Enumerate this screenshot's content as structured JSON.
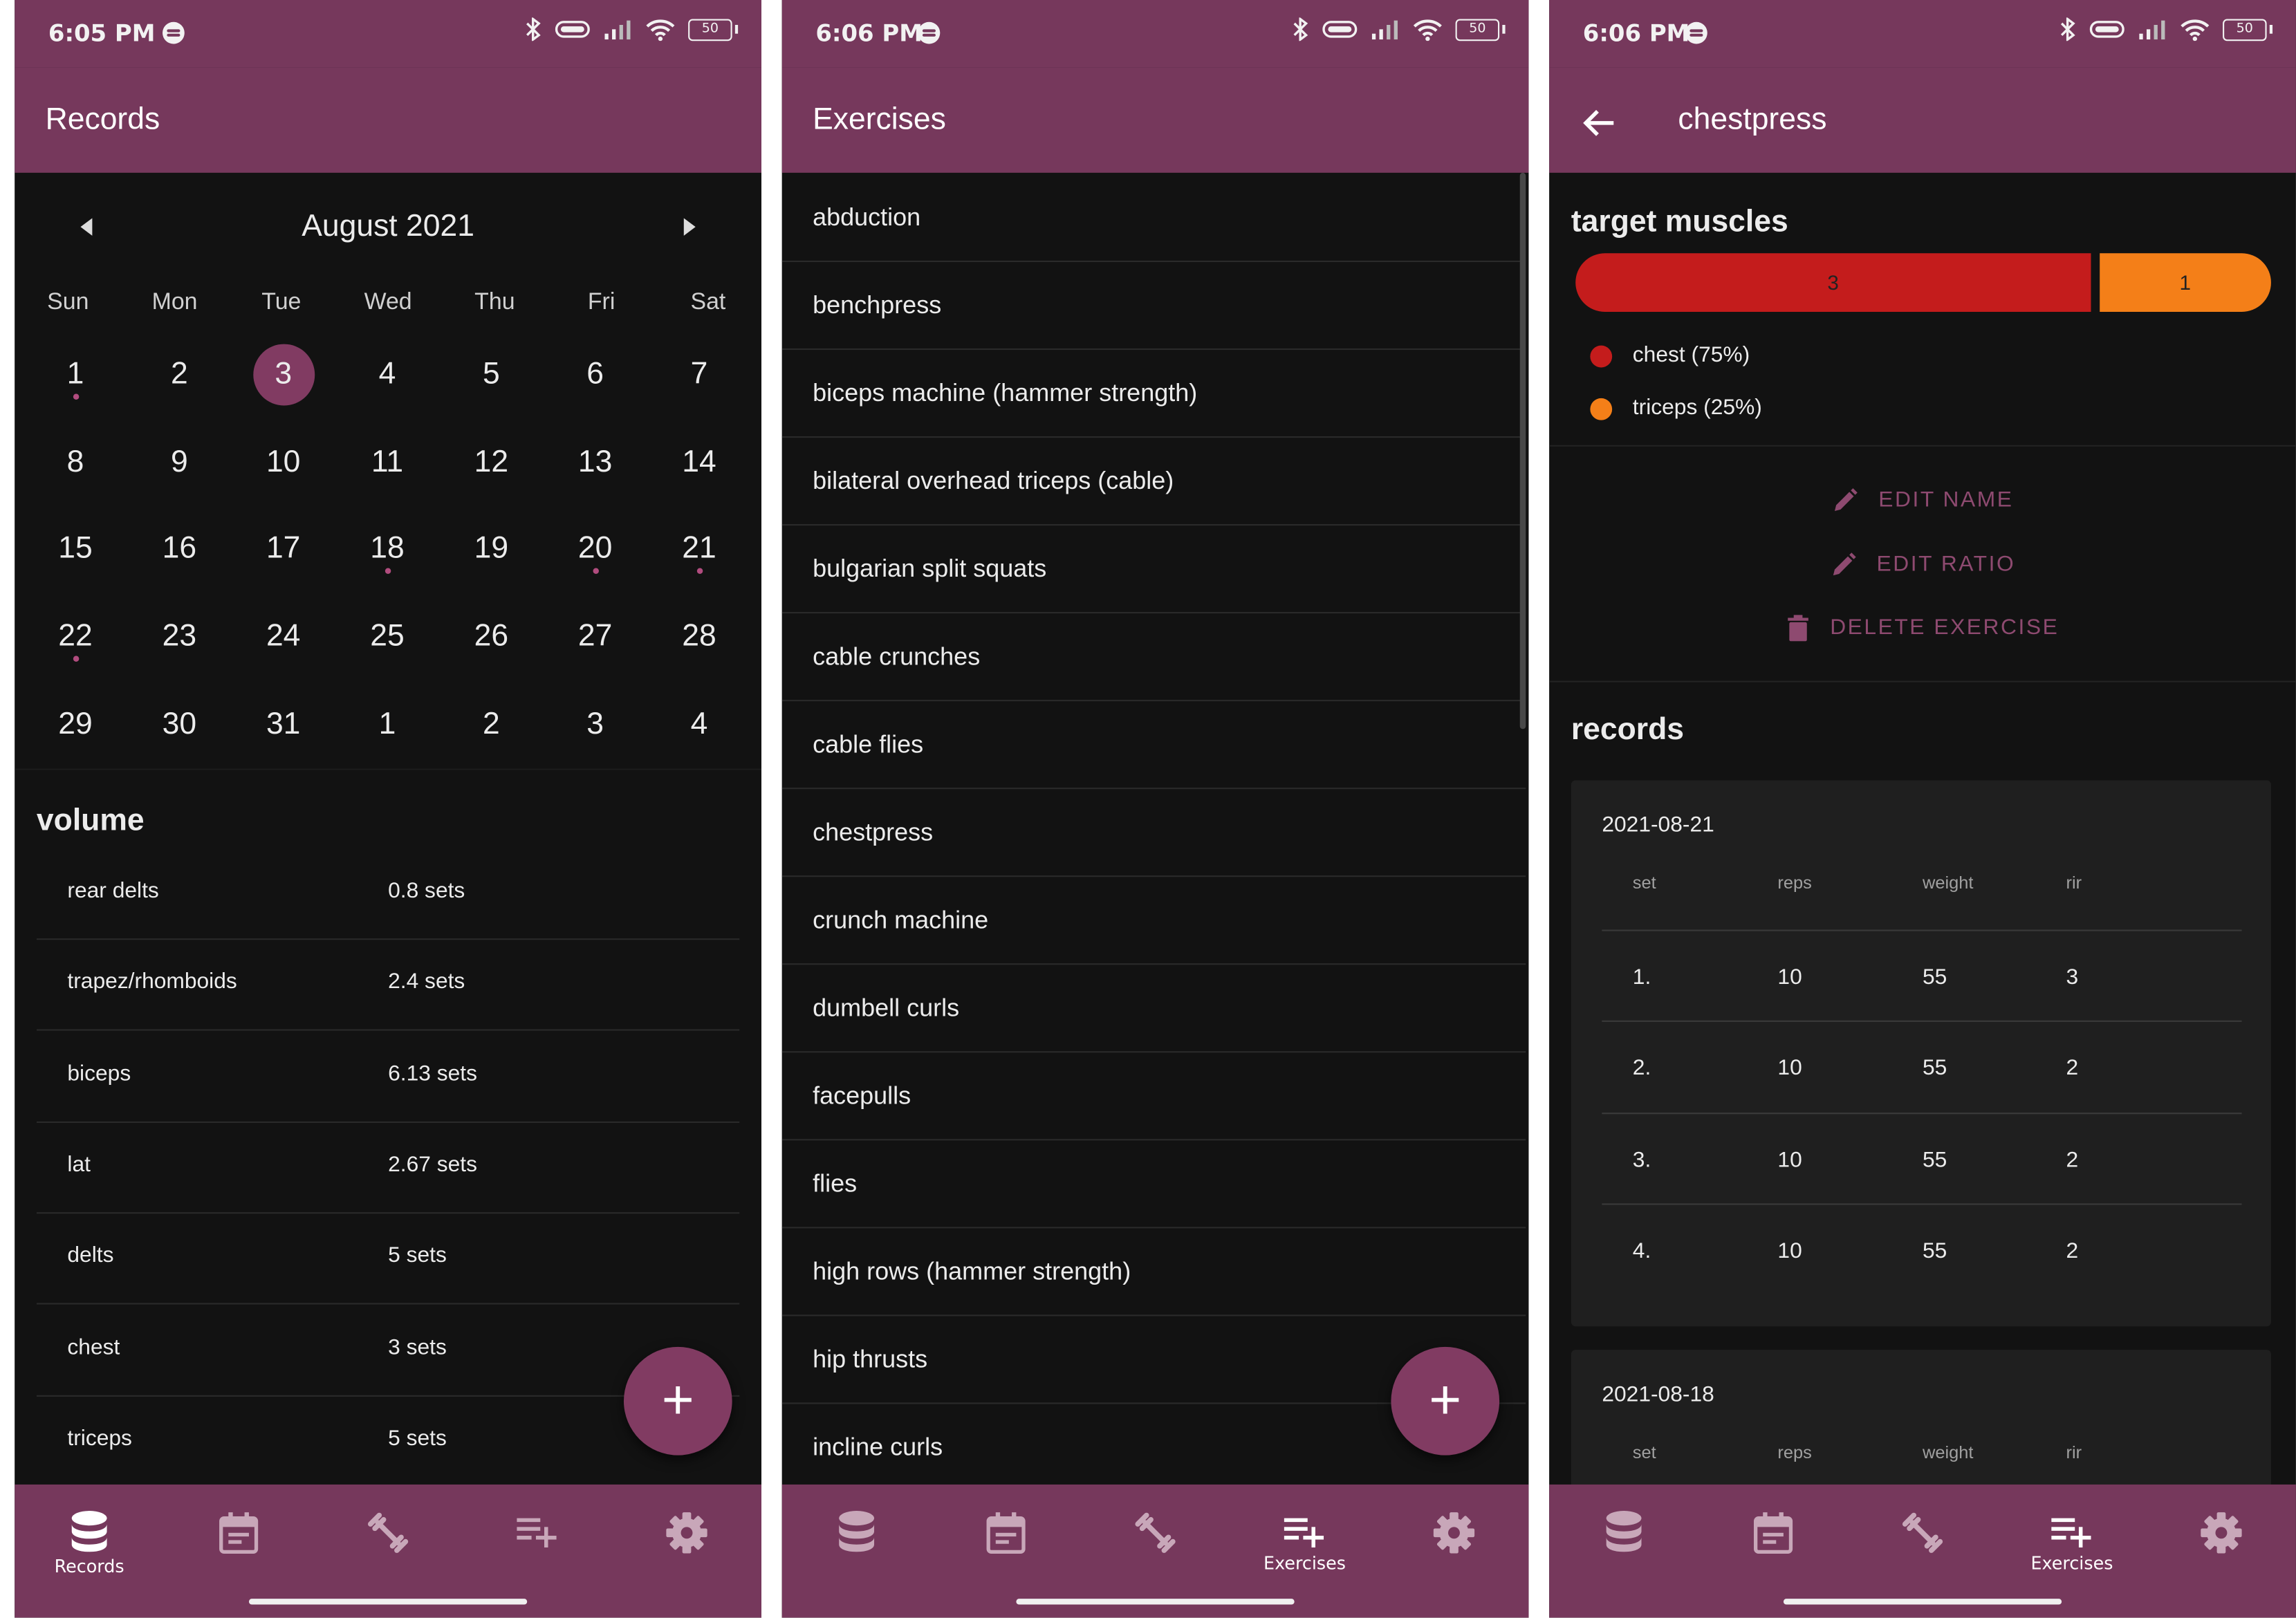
{
  "screens": [
    {
      "status_time": "6:05 PM",
      "battery": "50",
      "title": "Records",
      "calendar": {
        "month": "August 2021",
        "weekdays": [
          "Sun",
          "Mon",
          "Tue",
          "Wed",
          "Thu",
          "Fri",
          "Sat"
        ],
        "days": [
          "1",
          "2",
          "3",
          "4",
          "5",
          "6",
          "7",
          "8",
          "9",
          "10",
          "11",
          "12",
          "13",
          "14",
          "15",
          "16",
          "17",
          "18",
          "19",
          "20",
          "21",
          "22",
          "23",
          "24",
          "25",
          "26",
          "27",
          "28",
          "29",
          "30",
          "31",
          "1",
          "2",
          "3",
          "4"
        ],
        "selected_day": "3",
        "days_with_records": [
          "1",
          "18",
          "20",
          "21",
          "22"
        ]
      },
      "volume": {
        "title": "volume",
        "rows": [
          {
            "muscle": "rear delts",
            "value": "0.8 sets"
          },
          {
            "muscle": "trapez/rhomboids",
            "value": "2.4 sets"
          },
          {
            "muscle": "biceps",
            "value": "6.13 sets"
          },
          {
            "muscle": "lat",
            "value": "2.67 sets"
          },
          {
            "muscle": "delts",
            "value": "5 sets"
          },
          {
            "muscle": "chest",
            "value": "3 sets"
          },
          {
            "muscle": "triceps",
            "value": "5 sets"
          }
        ]
      },
      "fab": "+",
      "nav_active_label": "Records"
    },
    {
      "status_time": "6:06 PM",
      "battery": "50",
      "title": "Exercises",
      "exercises": [
        "abduction",
        "benchpress",
        "biceps machine (hammer strength)",
        "bilateral overhead triceps (cable)",
        "bulgarian split squats",
        "cable crunches",
        "cable flies",
        "chestpress",
        "crunch machine",
        "dumbell curls",
        "facepulls",
        "flies",
        "high rows (hammer strength)",
        "hip thrusts",
        "incline curls"
      ],
      "fab": "+",
      "nav_active_label": "Exercises"
    },
    {
      "status_time": "6:06 PM",
      "battery": "50",
      "title": "chestpress",
      "target_muscles": {
        "title": "target muscles",
        "ratio": [
          {
            "label": "3",
            "share": 0.75,
            "color": "#c41c1c"
          },
          {
            "label": "1",
            "share": 0.25,
            "color": "#f47f18"
          }
        ],
        "legend": [
          {
            "text": "chest (75%)",
            "color": "#c41c1c"
          },
          {
            "text": "triceps (25%)",
            "color": "#f47f18"
          }
        ]
      },
      "actions": {
        "edit_name": "EDIT NAME",
        "edit_ratio": "EDIT RATIO",
        "delete": "DELETE EXERCISE"
      },
      "records": {
        "title": "records",
        "columns": [
          "set",
          "reps",
          "weight",
          "rir"
        ],
        "sessions": [
          {
            "date": "2021-08-21",
            "rows": [
              [
                "1.",
                "10",
                "55",
                "3"
              ],
              [
                "2.",
                "10",
                "55",
                "2"
              ],
              [
                "3.",
                "10",
                "55",
                "2"
              ],
              [
                "4.",
                "10",
                "55",
                "2"
              ]
            ]
          },
          {
            "date": "2021-08-18",
            "rows": []
          }
        ]
      },
      "nav_active_label": "Exercises"
    }
  ],
  "colors": {
    "bar": "#76385c",
    "accent": "#813b62",
    "background": "#121212",
    "card": "#1f1f1f"
  },
  "nav_icons": [
    "database-icon",
    "calendar-icon",
    "dumbbell-icon",
    "playlist-add-icon",
    "settings-icon"
  ]
}
